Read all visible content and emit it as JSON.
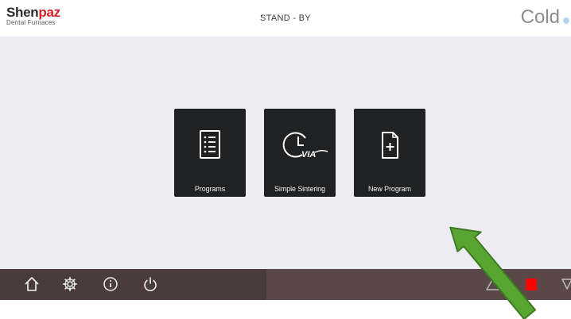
{
  "header": {
    "logo": {
      "name_part1": "Shen",
      "name_part2": "paz",
      "tagline": "Dental Furnaces"
    },
    "status": "STAND - BY",
    "temperature_label": "Cold"
  },
  "tiles": [
    {
      "label": "Programs",
      "icon": "program-list-icon"
    },
    {
      "label": "Simple Sintering",
      "icon": "clock-via-icon"
    },
    {
      "label": "New Program",
      "icon": "new-document-icon"
    }
  ],
  "footer": {
    "left_icons": [
      "home-icon",
      "gear-icon",
      "info-icon",
      "power-icon"
    ],
    "right_icons": [
      "warning-triangle-icon",
      "stop-icon",
      "down-triangle-icon"
    ]
  },
  "colors": {
    "tile": "#202122",
    "footer": "#5a4747",
    "brand_red": "#d4232a",
    "stop": "#ff0000",
    "annotation_arrow": "#4f9b2c"
  }
}
